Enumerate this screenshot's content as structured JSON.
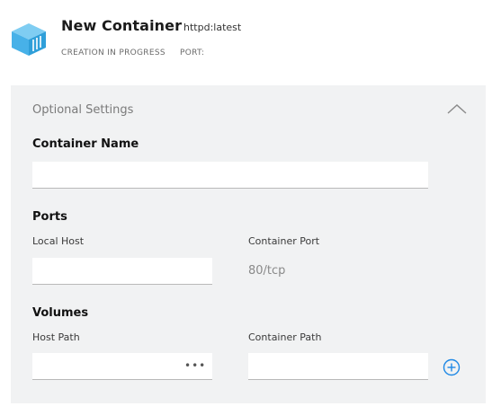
{
  "header": {
    "title": "New Container",
    "image": "httpd:latest",
    "status": "CREATION IN PROGRESS",
    "port_label": "PORT:",
    "logo_icon": "container-box-icon"
  },
  "panel": {
    "title": "Optional Settings",
    "collapse_icon": "chevron-up-icon",
    "container_name": {
      "label": "Container Name",
      "value": ""
    },
    "ports": {
      "label": "Ports",
      "local_host_label": "Local Host",
      "local_host_value": "",
      "container_port_label": "Container Port",
      "container_port_value": "80/tcp"
    },
    "volumes": {
      "label": "Volumes",
      "host_path_label": "Host Path",
      "host_path_value": "",
      "browse_label": "•••",
      "container_path_label": "Container Path",
      "container_path_value": "",
      "add_icon": "add-circle-icon"
    }
  },
  "colors": {
    "accent": "#1e88e5",
    "logo_blue": "#47b1e8",
    "panel_bg": "#f1f2f3"
  }
}
